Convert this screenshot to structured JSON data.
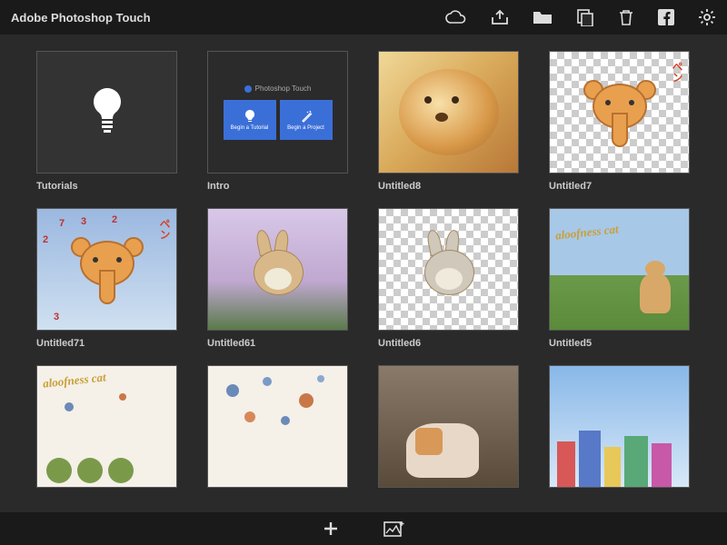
{
  "header": {
    "title": "Adobe Photoshop Touch",
    "icons": [
      "creative-cloud",
      "share",
      "folder",
      "duplicate",
      "delete",
      "facebook",
      "settings"
    ]
  },
  "intro": {
    "subtitle": "Photoshop Touch",
    "btn_tutorial": "Begin a Tutorial",
    "btn_project": "Begin a Project"
  },
  "projects": [
    {
      "label": "Tutorials",
      "kind": "tutorials"
    },
    {
      "label": "Intro",
      "kind": "intro"
    },
    {
      "label": "Untitled8",
      "kind": "plush"
    },
    {
      "label": "Untitled7",
      "kind": "elephant-checker"
    },
    {
      "label": "Untitled71",
      "kind": "elephant-annotated"
    },
    {
      "label": "Untitled61",
      "kind": "bunny-color"
    },
    {
      "label": "Untitled6",
      "kind": "bunny-checker"
    },
    {
      "label": "Untitled5",
      "kind": "cat-grass"
    },
    {
      "label": "",
      "kind": "splatter-green"
    },
    {
      "label": "",
      "kind": "splatter-plain"
    },
    {
      "label": "",
      "kind": "photo-cat"
    },
    {
      "label": "",
      "kind": "cityscape"
    }
  ],
  "overlay_text": {
    "pen_jp": "ペン",
    "aloofness": "aloofness cat"
  },
  "bottom": {
    "icons": [
      "add",
      "new-image"
    ]
  }
}
